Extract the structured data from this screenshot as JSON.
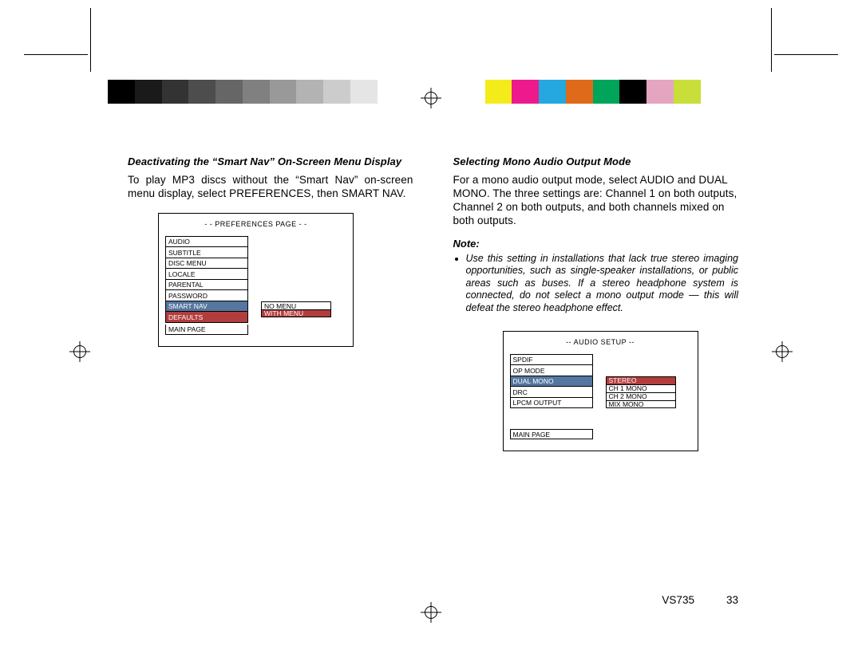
{
  "color_bars": {
    "left_gradient": [
      "#000000",
      "#1a1a1a",
      "#333333",
      "#4d4d4d",
      "#666666",
      "#808080",
      "#999999",
      "#b3b3b3",
      "#cccccc",
      "#e5e5e5",
      "#ffffff"
    ],
    "right_colors": [
      "#f4ec1a",
      "#ec1a8c",
      "#24a8df",
      "#df6b1a",
      "#00a55a",
      "#000000",
      "#e5a5c1",
      "#c8df3a",
      "#ffffff",
      "#ffffff"
    ]
  },
  "left": {
    "heading": "Deactivating the “Smart Nav” On-Screen Menu Display",
    "body": "To play MP3 discs without the “Smart Nav” on-screen menu display, select PREFERENCES, then SMART NAV.",
    "menu": {
      "title": "- -   PREFERENCES   PAGE   - -",
      "items": [
        "AUDIO",
        "SUBTITLE",
        "DISC MENU",
        "LOCALE",
        "PARENTAL",
        "PASSWORD",
        "SMART NAV",
        "DEFAULTS"
      ],
      "selected_idx": 6,
      "red_idx": 7,
      "sub": [
        "NO MENU",
        "WITH MENU"
      ],
      "sub_red_idx": 1,
      "main_page": "MAIN PAGE"
    }
  },
  "right": {
    "heading": "Selecting Mono Audio Output Mode",
    "body": "For a mono audio output mode, select AUDIO and DUAL MONO. The three settings are: Channel 1 on both outputs, Channel 2 on both outputs, and both channels mixed on both outputs.",
    "note_label": "Note:",
    "note_items": [
      "Use this setting in installations that lack true stereo imaging opportunities, such as single-speaker installations, or public areas such as buses. If a stereo headphone system is connected, do not select a mono output mode — this will defeat the stereo headphone effect."
    ],
    "menu": {
      "title": "-- AUDIO SETUP --",
      "items": [
        "SPDIF",
        "OP MODE",
        "DUAL MONO",
        "DRC",
        "LPCM OUTPUT"
      ],
      "selected_idx": 2,
      "sub": [
        "STEREO",
        "CH 1 MONO",
        "CH 2 MONO",
        "MIX MONO"
      ],
      "sub_red_idx": 0,
      "main_page": "MAIN PAGE"
    }
  },
  "footer": {
    "model": "VS735",
    "page": "33"
  }
}
